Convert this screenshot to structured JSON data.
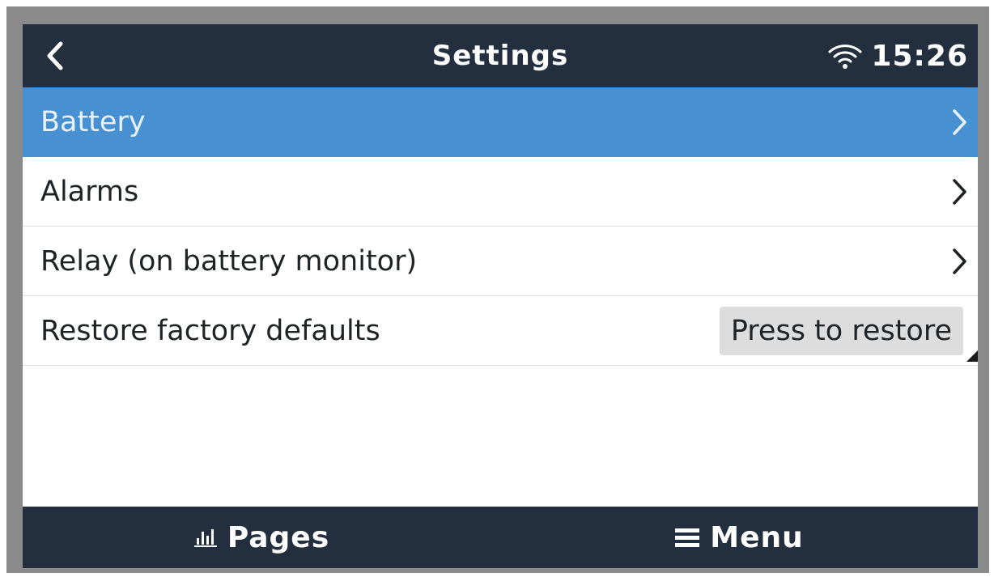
{
  "header": {
    "title": "Settings",
    "time": "15:26",
    "icons": {
      "back": "chevron-left-icon",
      "wifi": "wifi-icon"
    }
  },
  "menu": {
    "items": [
      {
        "label": "Battery",
        "selected": true,
        "icon": "chevron-right-icon"
      },
      {
        "label": "Alarms",
        "selected": false,
        "icon": "chevron-right-icon"
      },
      {
        "label": "Relay (on battery monitor)",
        "selected": false,
        "icon": "chevron-right-icon"
      },
      {
        "label": "Restore factory defaults",
        "selected": false,
        "button_label": "Press to restore"
      }
    ]
  },
  "footer": {
    "pages_label": "Pages",
    "menu_label": "Menu",
    "icons": {
      "pages": "bar-chart-icon",
      "menu": "hamburger-menu-icon"
    }
  },
  "colors": {
    "bar_background": "#232f3e",
    "selected_row": "#4790d2",
    "button_background": "#dddddd",
    "bezel": "#8a8a8a"
  }
}
